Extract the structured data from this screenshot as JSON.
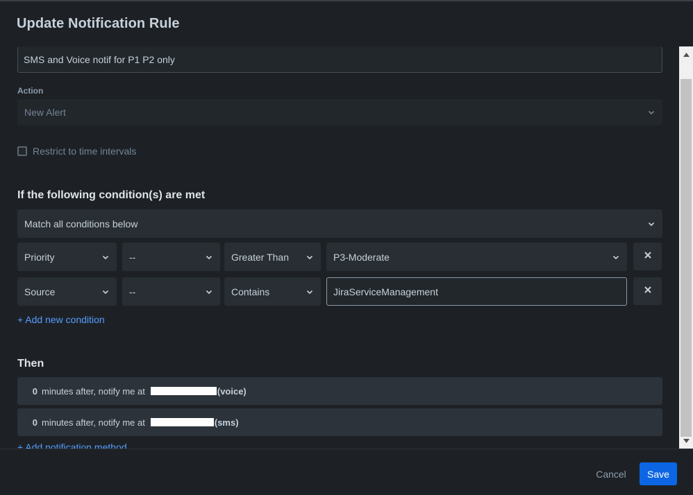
{
  "dialog": {
    "title": "Update Notification Rule"
  },
  "form": {
    "name_value": "SMS and Voice notif for P1 P2 only",
    "action_label": "Action",
    "action_value": "New Alert",
    "restrict_label": "Restrict to time intervals",
    "restrict_checked": false
  },
  "conditions": {
    "title": "If the following condition(s) are met",
    "match_value": "Match all conditions below",
    "rows": [
      {
        "field": "Priority",
        "not": "--",
        "operator": "Greater Than",
        "value": "P3-Moderate"
      },
      {
        "field": "Source",
        "not": "--",
        "operator": "Contains",
        "value": "JiraServiceManagement"
      }
    ],
    "add_label": "+ Add new condition"
  },
  "then": {
    "title": "Then",
    "rows": [
      {
        "minutes": "0",
        "text": "minutes after, notify me at",
        "method": "(voice)"
      },
      {
        "minutes": "0",
        "text": "minutes after, notify me at",
        "method": "(sms)"
      }
    ],
    "add_label": "+ Add notification method"
  },
  "footer": {
    "cancel_label": "Cancel",
    "save_label": "Save"
  },
  "colors": {
    "accent": "#0c66e4",
    "link": "#579dff",
    "background": "#1d2125"
  }
}
